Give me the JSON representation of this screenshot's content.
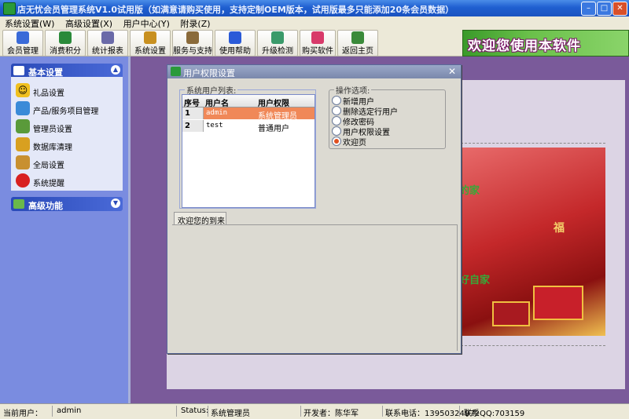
{
  "window": {
    "title": "店无忧会员管理系统V1.0试用版（如满意请购买使用，支持定制OEM版本，试用版最多只能添加20条会员数据）",
    "min_label": "–",
    "max_label": "□",
    "close_label": "✕"
  },
  "menu": [
    "系统设置(W)",
    "高级设置(X)",
    "用户中心(Y)",
    "附录(Z)"
  ],
  "toolbar": {
    "buttons": [
      {
        "label": "会员管理",
        "icon": "member-icon",
        "color": "#3a6ad8"
      },
      {
        "label": "消费积分",
        "icon": "points-icon",
        "color": "#2a8a3a"
      },
      {
        "label": "统计报表",
        "icon": "report-icon",
        "color": "#6a6aa8"
      },
      {
        "label": "系统设置",
        "icon": "settings-icon",
        "color": "#c89020"
      },
      {
        "label": "服务与支持",
        "icon": "support-icon",
        "color": "#8a6a3a"
      },
      {
        "label": "使用帮助",
        "icon": "help-icon",
        "color": "#2a5ad8"
      },
      {
        "label": "升级检测",
        "icon": "upgrade-icon",
        "color": "#3a9a6a"
      },
      {
        "label": "购买软件",
        "icon": "buy-icon",
        "color": "#d83a6a"
      },
      {
        "label": "返回主页",
        "icon": "home-icon",
        "color": "#3a8a3a"
      }
    ],
    "banner_text": "欢迎您使用本软件"
  },
  "sidebar": {
    "panel1_title": "基本设置",
    "panel2_title": "高级功能",
    "items": [
      {
        "label": "礼品设置",
        "icon": "smiley-icon",
        "color": "#f0c020"
      },
      {
        "label": "产品/服务项目管理",
        "icon": "product-icon",
        "color": "#3a8ad8"
      },
      {
        "label": "管理员设置",
        "icon": "users-icon",
        "color": "#5a9a3a"
      },
      {
        "label": "数据库清理",
        "icon": "database-icon",
        "color": "#d8a020"
      },
      {
        "label": "全局设置",
        "icon": "global-settings-icon",
        "color": "#c89030"
      },
      {
        "label": "系统提醒",
        "icon": "alarm-icon",
        "color": "#d82020"
      }
    ]
  },
  "dialog": {
    "title": "用户权限设置",
    "close_label": "✕",
    "user_list_label": "系统用户列表:",
    "columns": [
      "序号",
      "用户名",
      "用户权限"
    ],
    "rows": [
      {
        "no": "1",
        "username": "admin",
        "role": "系统管理员"
      },
      {
        "no": "2",
        "username": "test",
        "role": "普通用户"
      }
    ],
    "options_label": "操作选项:",
    "options": [
      {
        "label": "新增用户",
        "checked": false
      },
      {
        "label": "删除选定行用户",
        "checked": false
      },
      {
        "label": "修改密码",
        "checked": false
      },
      {
        "label": "用户权限设置",
        "checked": false
      },
      {
        "label": "欢迎页",
        "checked": true
      }
    ],
    "tab_label": "欢迎您的到来"
  },
  "content": {
    "pic_text1": "的家",
    "pic_text2": "好自家",
    "pic_text3": "福"
  },
  "status": {
    "current_user_label": "当前用户：",
    "current_user": "admin",
    "status_label": "Status:",
    "status_value": "系统管理员",
    "developer": "开发者：陈华军",
    "phone": "联系电话：13950324972",
    "qq": "联系QQ:703159"
  }
}
